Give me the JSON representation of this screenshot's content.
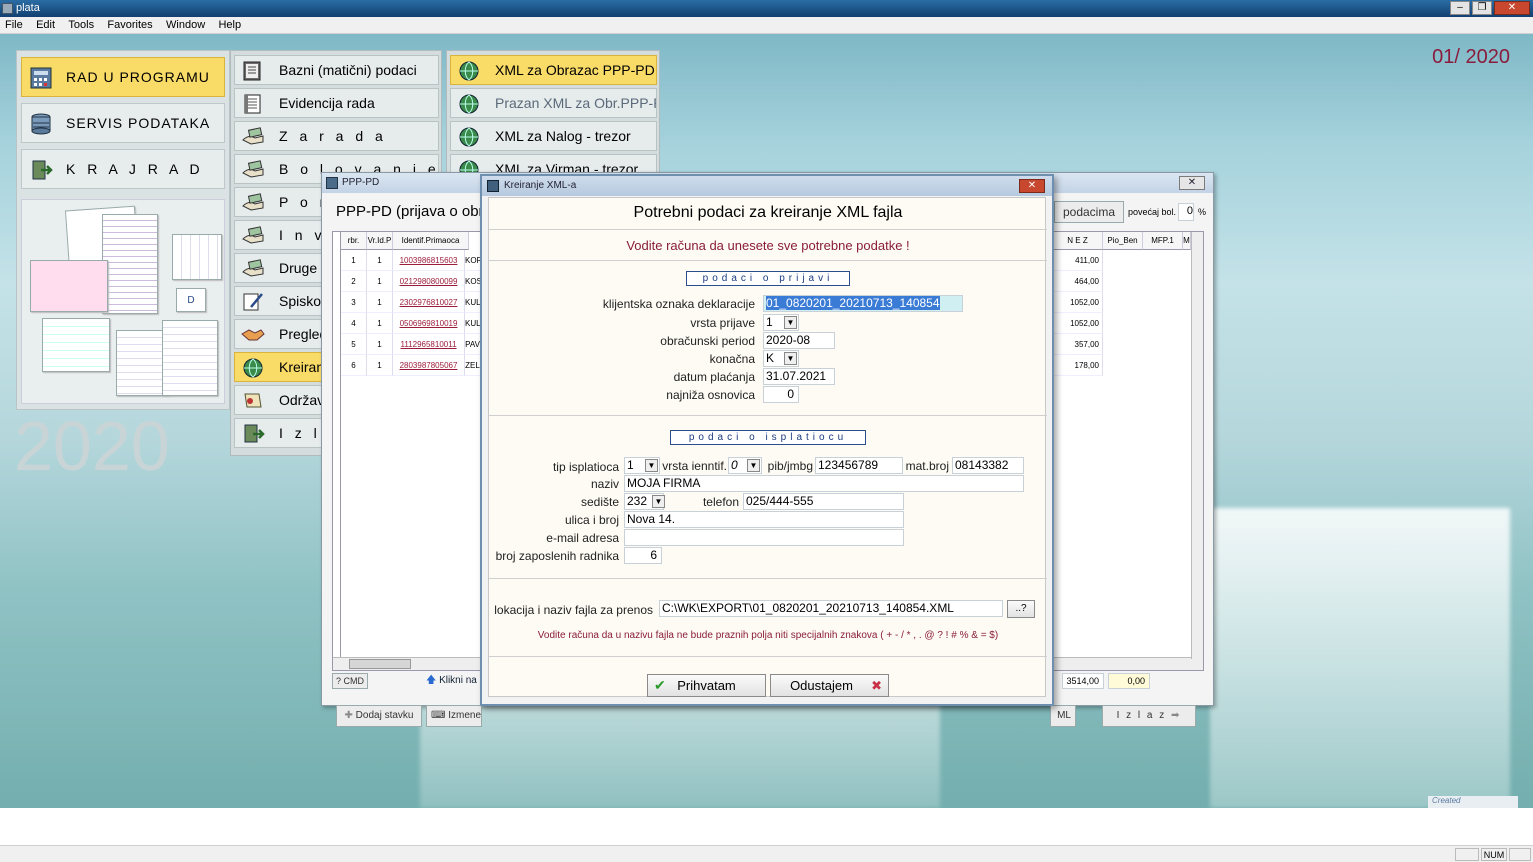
{
  "app": {
    "title": "plata"
  },
  "menu": [
    "File",
    "Edit",
    "Tools",
    "Favorites",
    "Window",
    "Help"
  ],
  "window_controls": {
    "minimize": "–",
    "restore": "❐",
    "close": "✕"
  },
  "period": "01/ 2020",
  "year": "2020",
  "left_menu": [
    {
      "label": "RAD  U  PROGRAMU",
      "icon": "calculator-icon",
      "active": true
    },
    {
      "label": "SERVIS PODATAKA",
      "icon": "database-icon",
      "active": false
    },
    {
      "label": "K R A J   R A D A",
      "icon": "exit-door-icon",
      "active": false
    }
  ],
  "docs_letter": "D",
  "middle_menu": [
    {
      "label": "Bazni (matični) podaci",
      "icon": "book-icon"
    },
    {
      "label": "Evidencija rada",
      "icon": "notebook-icon"
    },
    {
      "label": "Z a r a d a",
      "icon": "hand-money-icon"
    },
    {
      "label": "B o l o v a n j e",
      "icon": "hand-money-icon"
    },
    {
      "label": "P o r o",
      "icon": "hand-money-icon"
    },
    {
      "label": "I n v a",
      "icon": "hand-money-icon"
    },
    {
      "label": "Druge",
      "icon": "hand-money-icon"
    },
    {
      "label": "Spiskov",
      "icon": "pen-paper-icon"
    },
    {
      "label": "Pregled",
      "icon": "handshake-icon"
    },
    {
      "label": "Kreiran",
      "icon": "globe-icon",
      "active": true
    },
    {
      "label": "Održav",
      "icon": "scroll-icon"
    },
    {
      "label": "I z l a",
      "icon": "exit-door-icon"
    }
  ],
  "xml_menu": [
    {
      "label": "XML za Obrazac PPP-PD",
      "active": true
    },
    {
      "label": "Prazan XML za Obr.PPP-PD",
      "dim": true
    },
    {
      "label": "XML za Nalog - trezor"
    },
    {
      "label": "XML za Virman - trezor"
    }
  ],
  "ppp_window": {
    "title": "PPP-PD",
    "heading": "PPP-PD (prijava o obr",
    "podacima": "podacima",
    "povecaj_label": "povećaj bol.",
    "povecaj_value": "0",
    "pct": "%",
    "columns": [
      "rbr.",
      "Vr.Id.P",
      "Identif.Primaoca"
    ],
    "right_columns": [
      "N E Z",
      "Pio_Ben",
      "MFP.1",
      "M"
    ],
    "rows": [
      {
        "rbr": "1",
        "vr": "1",
        "id": "1003986815603",
        "name": "KOR",
        "nez": "411,00"
      },
      {
        "rbr": "2",
        "vr": "1",
        "id": "0212980800099",
        "name": "KOS",
        "nez": "464,00"
      },
      {
        "rbr": "3",
        "vr": "1",
        "id": "2302976810027",
        "name": "KUL",
        "nez": "1052,00"
      },
      {
        "rbr": "4",
        "vr": "1",
        "id": "0506969810019",
        "name": "KUL",
        "nez": "1052,00"
      },
      {
        "rbr": "5",
        "vr": "1",
        "id": "1112965810011",
        "name": "PAV",
        "nez": "357,00"
      },
      {
        "rbr": "6",
        "vr": "1",
        "id": "2803987805067",
        "name": "ZEL",
        "nez": "178,00"
      }
    ],
    "cmd_label": "? CMD",
    "hint": "Klikni na I",
    "total_nez": "3514,00",
    "total_other": "0,00",
    "add_label": "Dodaj stavku",
    "edit_label": "Izmene",
    "xml_btn": "ML",
    "exit_label": "I z l a z"
  },
  "dialog": {
    "title": "Kreiranje XML-a",
    "heading": "Potrebni podaci za kreiranje XML fajla",
    "warning": "Vodite računa da unesete sve potrebne podatke !",
    "section1": "podaci o prijavi",
    "klijentska_label": "klijentska oznaka deklaracije",
    "klijentska_value": "01_0820201_20210713_140854",
    "vrsta_label": "vrsta prijave",
    "vrsta_value": "1",
    "obracunski_label": "obračunski period",
    "obracunski_value": "2020-08",
    "konacna_label": "konačna",
    "konacna_value": "K",
    "datum_label": "datum plaćanja",
    "datum_value": "31.07.2021",
    "najniza_label": "najniža osnovica",
    "najniza_value": "0",
    "section2": "podaci o isplatiocu",
    "tip_label": "tip isplatioca",
    "tip_value": "1",
    "vrsta_ident_label": "vrsta ienntif.",
    "vrsta_ident_value": "0",
    "pib_label": "pib/jmbg",
    "pib_value": "123456789",
    "mat_label": "mat.broj",
    "mat_value": "08143382",
    "naziv_label": "naziv",
    "naziv_value": "MOJA FIRMA",
    "sediste_label": "sedište",
    "sediste_value": "232",
    "telefon_label": "telefon",
    "telefon_value": "025/444-555",
    "ulica_label": "ulica i broj",
    "ulica_value": "Nova 14.",
    "email_label": "e-mail adresa",
    "email_value": "",
    "broj_label": "broj zaposlenih radnika",
    "broj_value": "6",
    "lokacija_label": "lokacija i naziv fajla za prenos",
    "lokacija_value": "C:\\WK\\EXPORT\\01_0820201_20210713_140854.XML",
    "browse_label": "..?",
    "note": "Vodite računa da u nazivu fajla ne bude praznih polja niti specijalnih znakova ( + - / * , . @ ? ! # % & = $)",
    "accept": "Prihvatam",
    "cancel": "Odustajem",
    "check_glyph": "✔",
    "cross_glyph": "✖"
  },
  "created_badge": "Created",
  "status": {
    "num": "NUM"
  },
  "colors": {
    "accent": "#f9db68",
    "dialog_red": "#8a1c3c",
    "section_blue": "#1a3a80"
  }
}
